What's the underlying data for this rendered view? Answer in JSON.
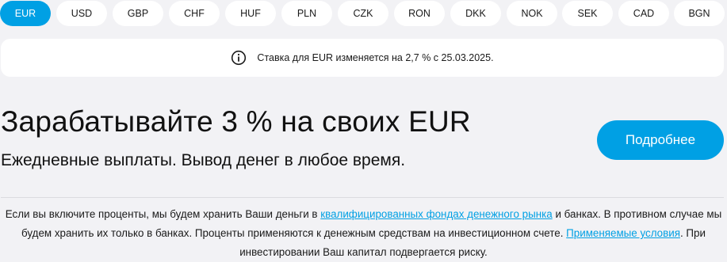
{
  "currency_tabs": [
    {
      "label": "EUR",
      "active": true
    },
    {
      "label": "USD",
      "active": false
    },
    {
      "label": "GBP",
      "active": false
    },
    {
      "label": "CHF",
      "active": false
    },
    {
      "label": "HUF",
      "active": false
    },
    {
      "label": "PLN",
      "active": false
    },
    {
      "label": "CZK",
      "active": false
    },
    {
      "label": "RON",
      "active": false
    },
    {
      "label": "DKK",
      "active": false
    },
    {
      "label": "NOK",
      "active": false
    },
    {
      "label": "SEK",
      "active": false
    },
    {
      "label": "CAD",
      "active": false
    },
    {
      "label": "BGN",
      "active": false
    }
  ],
  "notice": {
    "icon": "info-icon",
    "text": "Ставка для EUR изменяется на 2,7 % с 25.03.2025."
  },
  "promo": {
    "headline": "Зарабатывайте 3 % на своих EUR",
    "subline": "Ежедневные выплаты. Вывод денег в любое время.",
    "button_label": "Подробнее"
  },
  "disclaimer": {
    "part1": "Если вы включите проценты, мы будем хранить Ваши деньги в ",
    "link1": "квалифицированных фондах денежного рынка",
    "part2": " и банках. В противном случае мы будем хранить их только в банках. Проценты применяются к денежным средствам на инвестиционном счете. ",
    "link2": "Применяемые условия",
    "part3": ". При инвестировании Ваш капитал подвергается риску."
  },
  "colors": {
    "accent": "#00a0e4",
    "background": "#f2f2f5",
    "card": "#ffffff"
  }
}
